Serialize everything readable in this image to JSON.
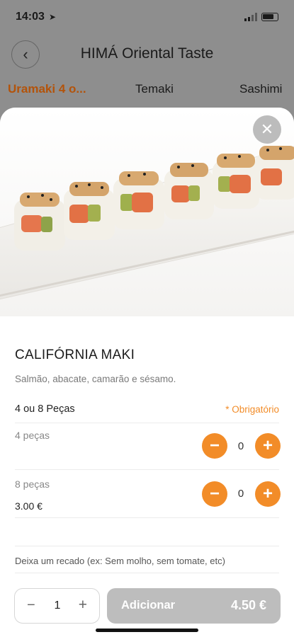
{
  "status": {
    "time": "14:03"
  },
  "header": {
    "title": "HIMÁ Oriental Taste"
  },
  "tabs": [
    {
      "label": "Uramaki 4 o..."
    },
    {
      "label": "Temaki"
    },
    {
      "label": "Sashimi"
    }
  ],
  "product": {
    "name": "CALIFÓRNIA MAKI",
    "description": "Salmão, abacate, camarão e sésamo."
  },
  "option_group": {
    "title": "4 ou 8 Peças",
    "required_label": "* Obrigatório",
    "options": [
      {
        "label": "4 peças",
        "quantity": "0",
        "price": ""
      },
      {
        "label": "8 peças",
        "quantity": "0",
        "price": "3.00 €"
      }
    ]
  },
  "note": {
    "placeholder": "Deixa um recado (ex: Sem molho, sem tomate, etc)"
  },
  "footer": {
    "quantity": "1",
    "add_label": "Adicionar",
    "total": "4.50 €"
  },
  "colors": {
    "accent": "#f28c28",
    "active_tab": "#b3530a",
    "disabled_button": "#bdbdbd"
  },
  "icons": {
    "back": "chevron-left-icon",
    "close": "close-icon",
    "minus": "minus-icon",
    "plus": "plus-icon"
  }
}
